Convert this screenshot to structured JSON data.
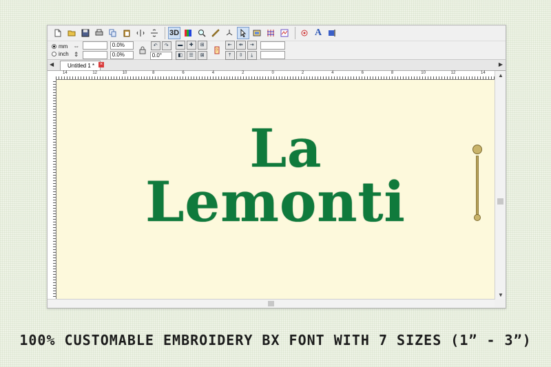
{
  "toolbar_main": {
    "icons": [
      "new-file-icon",
      "open-folder-icon",
      "save-icon",
      "print-icon",
      "copy-icon",
      "paste-icon",
      "mirror-icon",
      "flip-icon"
    ],
    "three_d_label": "3D",
    "view_icons": [
      "color-icon",
      "zoom-icon",
      "measure-icon",
      "node-icon",
      "select-icon",
      "stitch-icon",
      "grid-icon",
      "wave-icon"
    ],
    "font_label": "A",
    "extra_icons": [
      "thread-icon",
      "font-icon",
      "bar-icon"
    ]
  },
  "toolbar_props": {
    "unit_options": [
      "mm",
      "inch"
    ],
    "unit_selected": "mm",
    "width_value": "",
    "height_value": "",
    "width_percent": "0.0%",
    "height_percent": "0.0%",
    "rotation": "0.0°"
  },
  "tabs": {
    "doc_title": "Untitled 1 *"
  },
  "rulers": {
    "h_labels": [
      "14",
      "12",
      "10",
      "8",
      "6",
      "4",
      "2",
      "0",
      "2",
      "4",
      "6",
      "8",
      "10",
      "12",
      "14"
    ]
  },
  "canvas": {
    "background": "#fdf9dc",
    "thread_color": "#0f7a3c",
    "line1": "La",
    "line2": "Lemonti"
  },
  "caption": "100% CUSTOMABLE EMBROIDERY BX FONT WITH 7 SIZES (1” -  3”)"
}
